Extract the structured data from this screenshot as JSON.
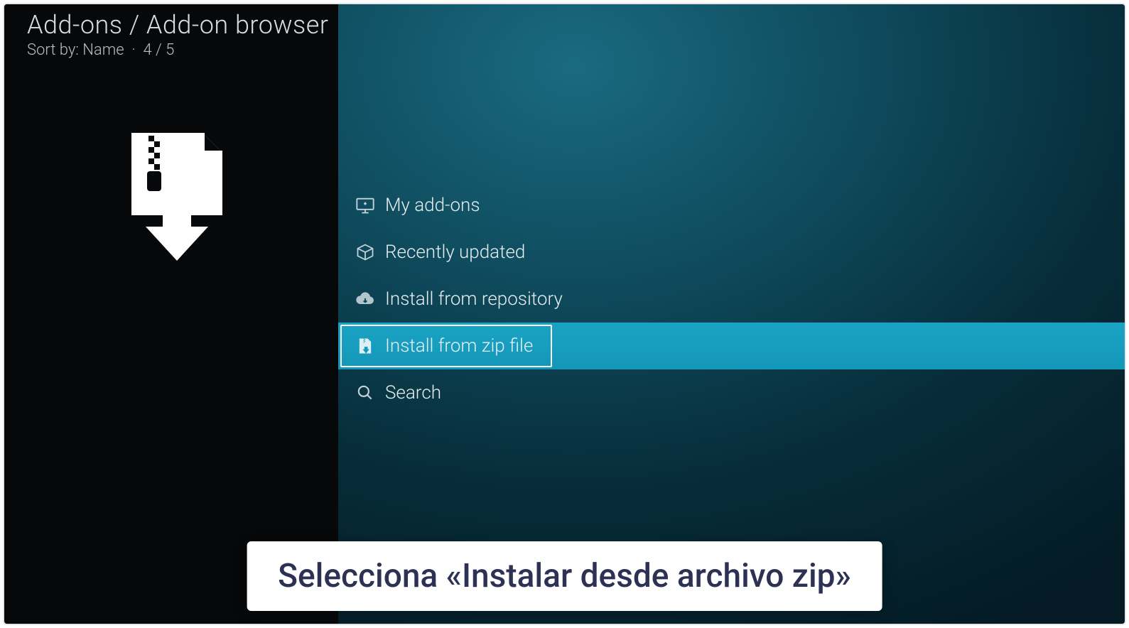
{
  "header": {
    "breadcrumb": "Add-ons / Add-on browser",
    "sort_label": "Sort by: Name",
    "position": "4 / 5"
  },
  "menu": {
    "items": [
      {
        "icon": "screen-icon",
        "label": "My add-ons",
        "selected": false
      },
      {
        "icon": "box-icon",
        "label": "Recently updated",
        "selected": false
      },
      {
        "icon": "cloud-icon",
        "label": "Install from repository",
        "selected": false
      },
      {
        "icon": "zip-icon",
        "label": "Install from zip file",
        "selected": true
      },
      {
        "icon": "search-icon",
        "label": "Search",
        "selected": false
      }
    ]
  },
  "caption": "Selecciona «Instalar desde archivo zip»"
}
